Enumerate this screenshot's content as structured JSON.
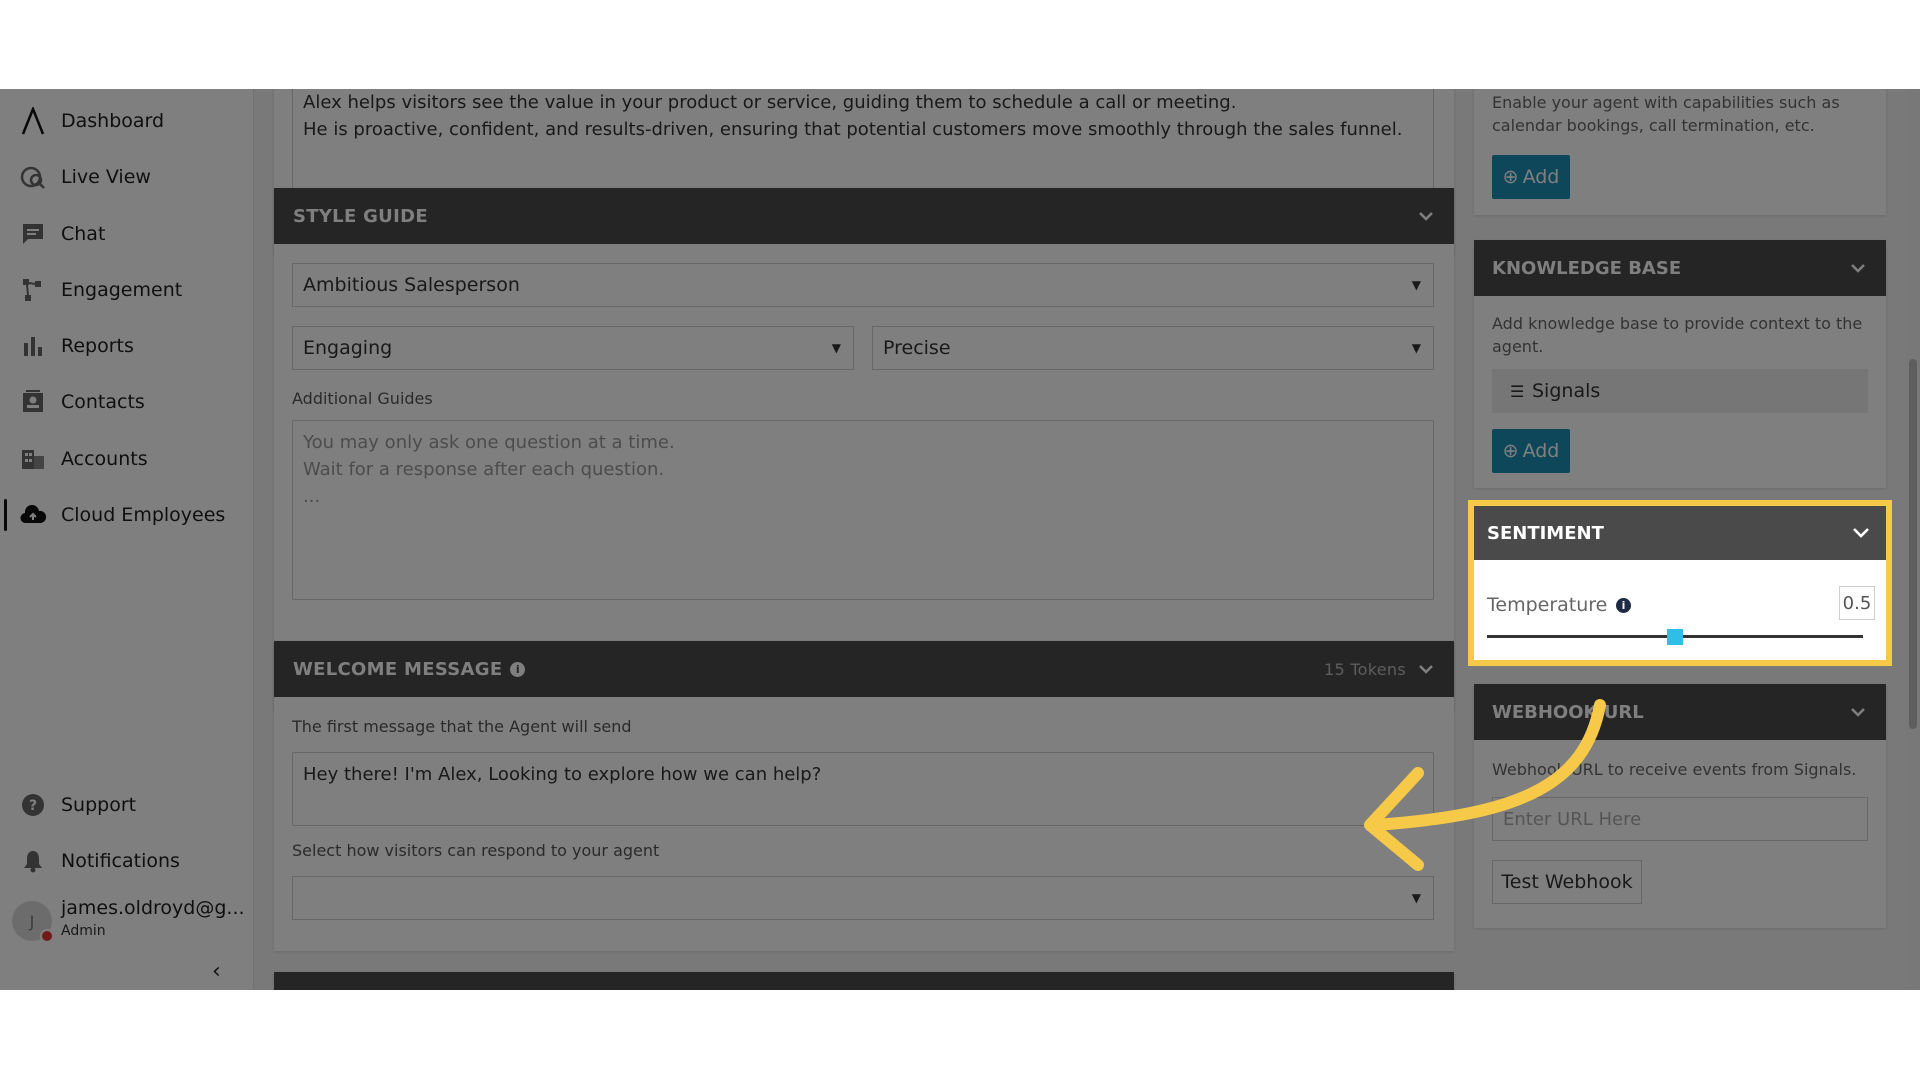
{
  "sidebar": {
    "items": [
      {
        "label": "Dashboard",
        "icon": "logo-icon"
      },
      {
        "label": "Live View",
        "icon": "live-view-icon"
      },
      {
        "label": "Chat",
        "icon": "chat-icon"
      },
      {
        "label": "Engagement",
        "icon": "engagement-icon"
      },
      {
        "label": "Reports",
        "icon": "reports-icon"
      },
      {
        "label": "Contacts",
        "icon": "contacts-icon"
      },
      {
        "label": "Accounts",
        "icon": "accounts-icon"
      },
      {
        "label": "Cloud Employees",
        "icon": "cloud-employees-icon",
        "active": true
      }
    ],
    "bottom": [
      {
        "label": "Support",
        "icon": "support-icon"
      },
      {
        "label": "Notifications",
        "icon": "bell-icon"
      }
    ],
    "user": {
      "initial": "J",
      "name": "james.oldroyd@g...",
      "role": "Admin"
    },
    "collapse": "‹"
  },
  "persona": {
    "text_line1": "Alex helps visitors see the value in your product or service, guiding them to schedule a call or meeting.",
    "text_line2": "He is proactive, confident, and results-driven, ensuring that potential customers move smoothly through the sales funnel."
  },
  "style_guide": {
    "title": "STYLE GUIDE",
    "persona_select": "Ambitious Salesperson",
    "tone_select": "Engaging",
    "precision_select": "Precise",
    "additional_label": "Additional Guides",
    "additional_placeholder_1": "You may only ask one question at a time.",
    "additional_placeholder_2": "Wait for a response after each question.",
    "additional_placeholder_3": "..."
  },
  "welcome": {
    "title": "WELCOME MESSAGE",
    "tokens": "15 Tokens",
    "first_label": "The first message that the Agent will send",
    "message": "Hey there! I'm Alex, Looking to explore how we can help?",
    "respond_label": "Select how visitors can respond to your agent",
    "respond_value": ""
  },
  "capabilities": {
    "desc": "Enable your agent with capabilities such as calendar bookings, call termination, etc.",
    "add": "Add"
  },
  "knowledge": {
    "title": "KNOWLEDGE BASE",
    "desc": "Add knowledge base to provide context to the agent.",
    "item": "Signals",
    "add": "Add"
  },
  "sentiment": {
    "title": "SENTIMENT",
    "temp_label": "Temperature",
    "temp_value": "0.5",
    "temperature": 0.5
  },
  "webhook": {
    "title": "WEBHOOK URL",
    "desc": "Webhook URL to receive events from Signals.",
    "placeholder": "Enter URL Here",
    "test": "Test Webhook"
  },
  "colors": {
    "accent": "#1c8fb5",
    "highlight": "#f7c948",
    "slider": "#2fbfe6",
    "arrow": "#f7c948"
  }
}
